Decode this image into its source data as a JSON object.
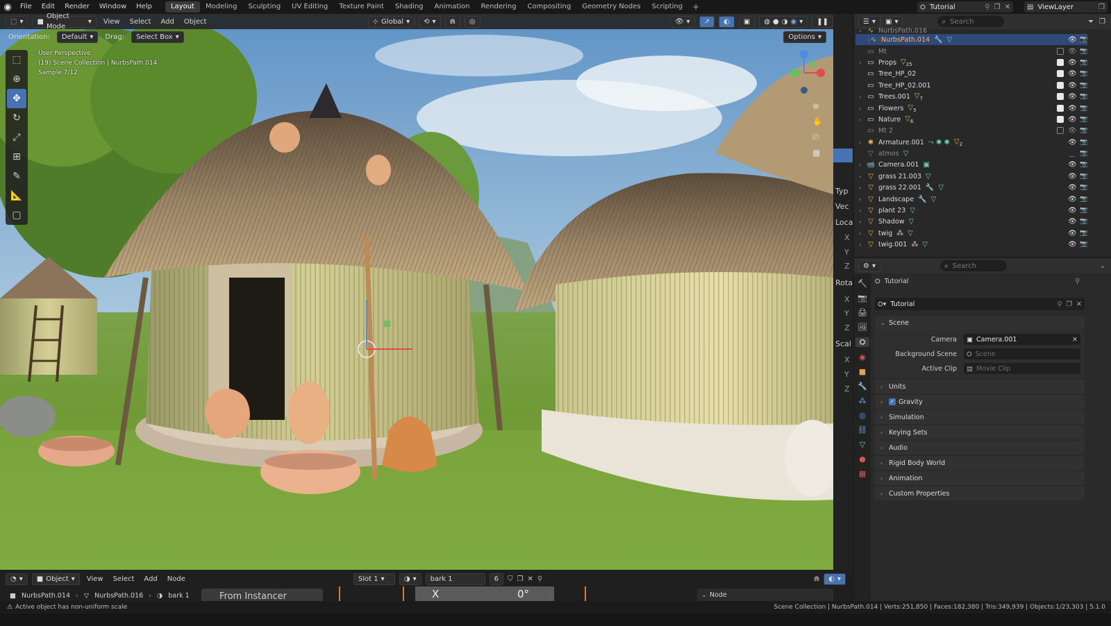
{
  "topbar": {
    "menus": [
      "File",
      "Edit",
      "Render",
      "Window",
      "Help"
    ],
    "workspaces": [
      "Layout",
      "Modeling",
      "Sculpting",
      "UV Editing",
      "Texture Paint",
      "Shading",
      "Animation",
      "Rendering",
      "Compositing",
      "Geometry Nodes",
      "Scripting"
    ],
    "active_workspace": "Layout",
    "scene_name": "Tutorial",
    "view_layer": "ViewLayer"
  },
  "viewport": {
    "mode": "Object Mode",
    "menus": [
      "View",
      "Select",
      "Add",
      "Object"
    ],
    "transform_orientation": "Global",
    "orientation_label": "Orientation:",
    "orientation_value": "Default",
    "drag_label": "Drag:",
    "drag_value": "Select Box",
    "options_label": "Options",
    "info": [
      "User Perspective",
      "(19) Scene Collection | NurbsPath.014",
      "Sample 7/12"
    ],
    "npanel_labels": [
      "Typ",
      "Vec",
      "Loca",
      "Rota",
      "Scal"
    ],
    "npanel_axes": [
      "X",
      "Y",
      "Z",
      "X",
      "Y",
      "Z",
      "X",
      "Y",
      "Z"
    ]
  },
  "outliner": {
    "search_placeholder": "Search",
    "rows": [
      {
        "name": "NurbsPath.016",
        "selected": false,
        "dim": true
      },
      {
        "name": "NurbsPath.014",
        "selected": true,
        "dim": false
      },
      {
        "name": "Mt",
        "selected": false,
        "dim": true
      },
      {
        "name": "Props",
        "badge": "25"
      },
      {
        "name": "Tree_HP_02"
      },
      {
        "name": "Tree_HP_02.001"
      },
      {
        "name": "Trees.001",
        "badge": "7"
      },
      {
        "name": "Flowers",
        "badge": "5"
      },
      {
        "name": "Nature",
        "badge": "6"
      },
      {
        "name": "Mt 2",
        "dim": true
      },
      {
        "name": "Armature.001",
        "badge": "2"
      },
      {
        "name": "atmos",
        "dim": true
      },
      {
        "name": "Camera.001"
      },
      {
        "name": "grass 21.003"
      },
      {
        "name": "grass 22.001"
      },
      {
        "name": "Landscape"
      },
      {
        "name": "plant 23"
      },
      {
        "name": "Shadow"
      },
      {
        "name": "twig"
      },
      {
        "name": "twig.001"
      }
    ]
  },
  "properties": {
    "search_placeholder": "Search",
    "context_title": "Tutorial",
    "scene_name": "Tutorial",
    "scene_panel": "Scene",
    "camera_label": "Camera",
    "camera_value": "Camera.001",
    "bg_scene_label": "Background Scene",
    "bg_scene_placeholder": "Scene",
    "active_clip_label": "Active Clip",
    "active_clip_placeholder": "Movie Clip",
    "panels": [
      "Units",
      "Gravity",
      "Simulation",
      "Keying Sets",
      "Audio",
      "Rigid Body World",
      "Animation",
      "Custom Properties"
    ]
  },
  "shader_editor": {
    "type": "Object",
    "menus": [
      "View",
      "Select",
      "Add",
      "Node"
    ],
    "slot": "Slot 1",
    "material": "bark 1",
    "users": "6",
    "breadcrumb": [
      "NurbsPath.014",
      "NurbsPath.016",
      "bark 1"
    ],
    "node_title": "From Instancer",
    "node_value_x": "X",
    "node_value_deg": "0°",
    "sidebar_node": "Node"
  },
  "statusbar": {
    "message": "Active object has non-uniform scale",
    "stats": "Scene Collection | NurbsPath.014 | Verts:251,850 | Faces:182,380 | Tris:349,939 | Objects:1/23,303 | 5.1.0"
  }
}
